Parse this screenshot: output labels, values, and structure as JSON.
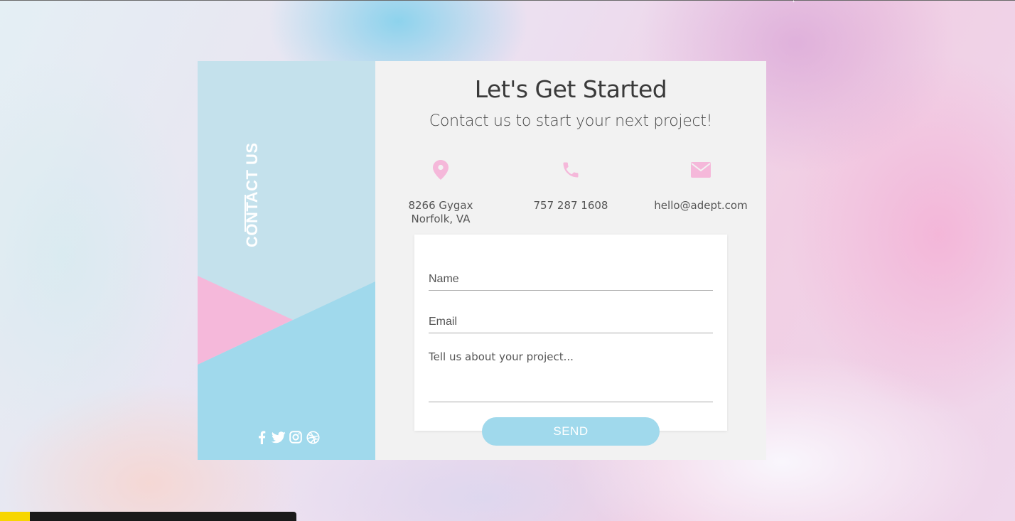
{
  "sidebar": {
    "vertical_title": "CONTACT US",
    "colors": {
      "panel": "#c4e1ec",
      "pink": "#f5b8da",
      "blue": "#a0d9ec"
    },
    "social_icons": [
      "facebook-icon",
      "twitter-icon",
      "instagram-icon",
      "dribbble-icon"
    ]
  },
  "main": {
    "title": "Let's Get Started",
    "subtitle": "Contact us to start your next project!",
    "contact": {
      "address_line1": "8266 Gygax",
      "address_line2": "Norfolk, VA",
      "phone": "757 287 1608",
      "email": "hello@adept.com",
      "icon_color": "#f5b8da"
    }
  },
  "form": {
    "name_placeholder": "Name",
    "email_placeholder": "Email",
    "message_placeholder": "Tell us about your project...",
    "send_label": "SEND"
  }
}
